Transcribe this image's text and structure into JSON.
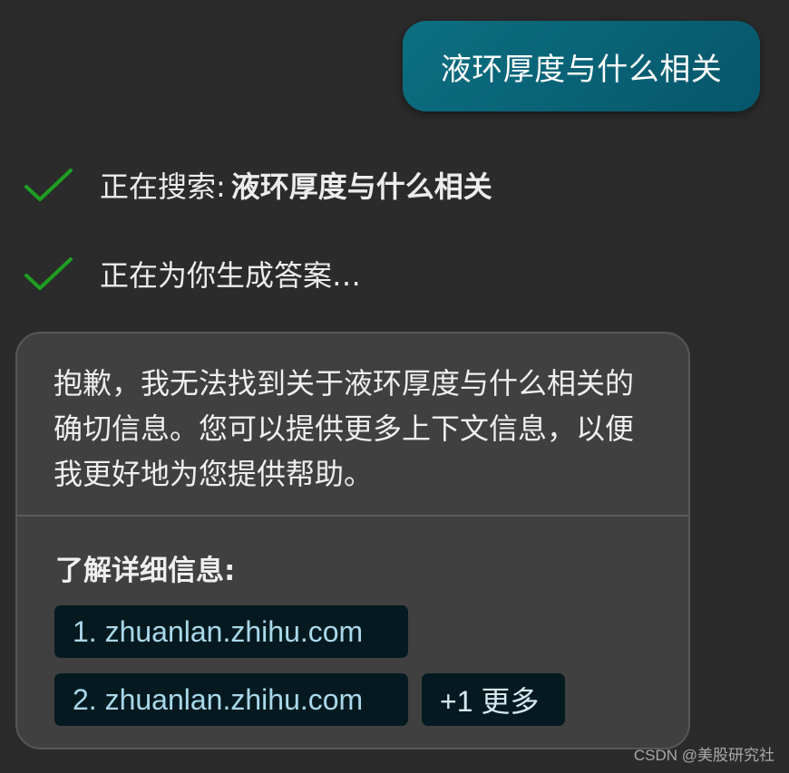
{
  "user_message": {
    "text": "液环厚度与什么相关"
  },
  "status": {
    "searching_label": "正在搜索:",
    "searching_query": "液环厚度与什么相关",
    "generating_label": "正在为你生成答案…"
  },
  "answer": {
    "text": "抱歉，我无法找到关于液环厚度与什么相关的确切信息。您可以提供更多上下文信息，以便我更好地为您提供帮助。",
    "learn_more_label": "了解详细信息:",
    "sources": [
      {
        "label": "1. zhuanlan.zhihu.com"
      },
      {
        "label": "2. zhuanlan.zhihu.com"
      }
    ],
    "more_label": "+1 更多"
  },
  "watermark": "CSDN @美股研究社",
  "colors": {
    "background": "#2b2b2b",
    "user_bubble": "#0a6477",
    "check": "#1e9e22",
    "card": "#404040",
    "chip_bg": "#051a20",
    "chip_text": "#a9d8ea"
  },
  "icons": {
    "status_check": "check-icon"
  }
}
